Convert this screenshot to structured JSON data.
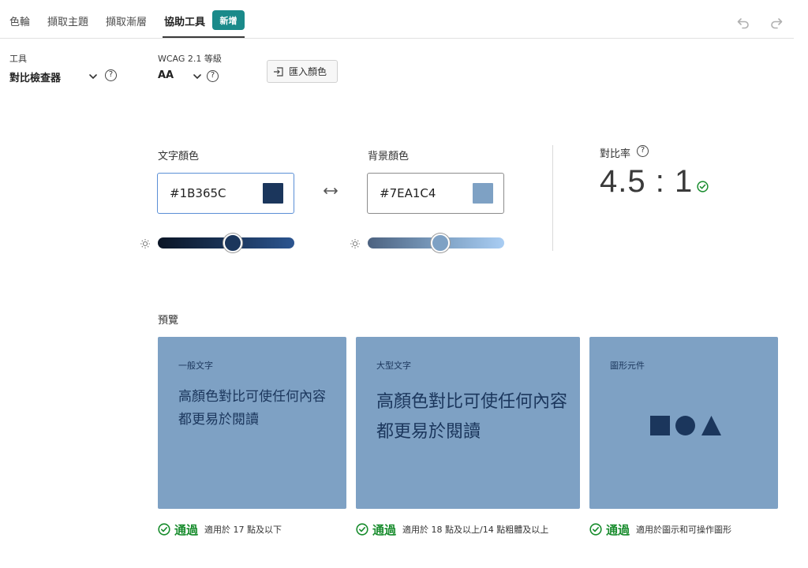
{
  "tabs": [
    {
      "label": "色輪"
    },
    {
      "label": "擷取主題"
    },
    {
      "label": "擷取漸層"
    },
    {
      "label": "協助工具"
    }
  ],
  "new_badge": "新增",
  "toolbar": {
    "tool_label": "工具",
    "tool_value": "對比檢查器",
    "wcag_label": "WCAG 2.1 等級",
    "wcag_value": "AA",
    "import_label": "匯入顏色"
  },
  "text_color": {
    "label": "文字顏色",
    "hex": "#1B365C",
    "swatch": "#1B365C",
    "brightness": 0.55
  },
  "background_color": {
    "label": "背景顏色",
    "hex": "#7EA1C4",
    "swatch": "#7EA1C4",
    "brightness": 0.53
  },
  "contrast": {
    "label": "對比率",
    "value": "4.5 : 1"
  },
  "preview": {
    "title": "預覽",
    "cards": [
      {
        "title": "一般文字",
        "text": "高顏色對比可使任何內容都更易於閱讀"
      },
      {
        "title": "大型文字",
        "text": "高顏色對比可使任何內容都更易於閱讀"
      },
      {
        "title": "圖形元件"
      }
    ],
    "results": [
      {
        "status": "通過",
        "desc": "適用於 17 點及以下"
      },
      {
        "status": "通過",
        "desc": "適用於 18 點及以上/14 點粗體及以上"
      },
      {
        "status": "通過",
        "desc": "適用於圖示和可操作圖形"
      }
    ]
  },
  "colors": {
    "accent_teal": "#1A8A8A",
    "pass_green": "#188C2D",
    "text_color": "#1B365C",
    "bg_color": "#7EA1C4"
  }
}
